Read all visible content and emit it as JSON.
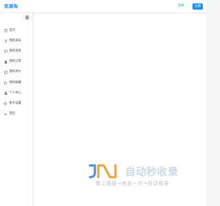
{
  "header": {
    "logo_text": "思源淘",
    "login_label": "登录",
    "register_label": "注册",
    "colors": {
      "accent": "#1890ff"
    }
  },
  "sidebar": {
    "collapse_icon": "hamburger-icon",
    "items": [
      {
        "label": "首页",
        "icon": "home-icon"
      },
      {
        "label": "我的发布",
        "icon": "upload-icon"
      },
      {
        "label": "我的消息",
        "icon": "message-icon"
      },
      {
        "label": "我的订单",
        "icon": "order-icon"
      },
      {
        "label": "我的评价",
        "icon": "review-icon"
      },
      {
        "label": "我的收藏",
        "icon": "star-icon"
      },
      {
        "label": "个人中心",
        "icon": "user-icon"
      },
      {
        "label": "账号设置",
        "icon": "gear-icon"
      },
      {
        "label": "登出",
        "icon": "logout-icon"
      }
    ]
  },
  "watermark": {
    "title": "自动秒收录",
    "slogan": "做上链接→来访一次→自动收录"
  }
}
